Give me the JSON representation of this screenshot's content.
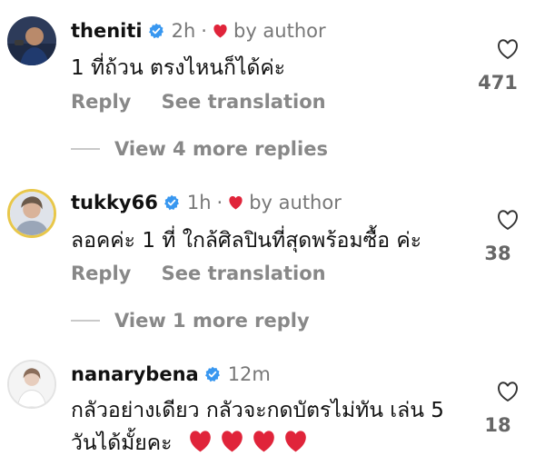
{
  "accent": "#e0243a",
  "verified_color": "#3897f0",
  "comments": [
    {
      "username": "theniti",
      "time": "2h",
      "dot": "·",
      "author_liked": "by author",
      "text": "1 ที่ถ้วน ตรงไหนก็ได้ค่ะ",
      "actions": {
        "reply": "Reply",
        "translate": "See translation"
      },
      "likes": "471",
      "more_replies": "View 4 more replies"
    },
    {
      "username": "tukky66",
      "time": "1h",
      "dot": "·",
      "author_liked": "by author",
      "text": "ลอคค่ะ  1 ที่  ใกล้ศิลปินที่สุดพร้อมซื้อ ค่ะ",
      "actions": {
        "reply": "Reply",
        "translate": "See translation"
      },
      "likes": "38",
      "more_replies": "View 1 more reply"
    },
    {
      "username": "nanarybena",
      "time": "12m",
      "text_line1": "กลัวอย่างเดียว กลัวจะกดบัตรไม่ทัน เล่น 5",
      "text_line2": "วันได้มั้ยคะ",
      "likes": "18"
    }
  ]
}
